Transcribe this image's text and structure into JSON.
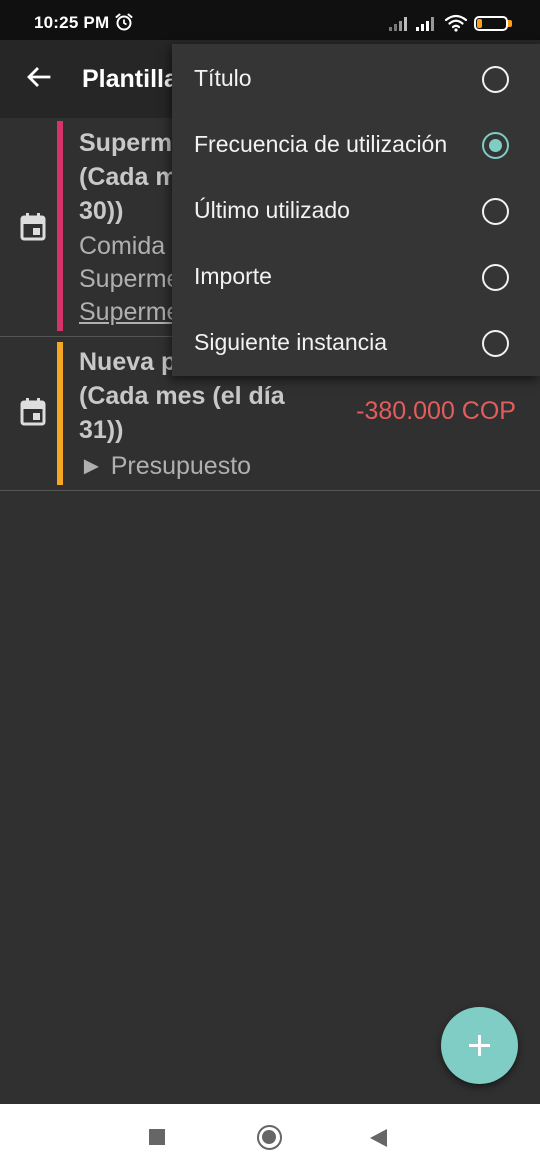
{
  "status_bar": {
    "time": "10:25 PM",
    "battery": "19",
    "battery_level": 0.19,
    "icons": [
      "alarm-icon",
      "signal-icon",
      "signal-icon",
      "wifi-icon",
      "battery-icon"
    ]
  },
  "app_bar": {
    "title": "Plantillas",
    "back_icon": "arrow-left-icon"
  },
  "list": {
    "rows": [
      {
        "title_lines": [
          "Supermercado",
          "(Cada mes (el día",
          "30))"
        ],
        "sub_lines": [
          "Comida",
          "Supermercado",
          "Supermercado"
        ],
        "amount": "",
        "accent": "#d6336c",
        "icon": "calendar-icon"
      },
      {
        "title_lines": [
          "Nueva plantilla",
          "(Cada mes (el día",
          "31))"
        ],
        "sub_lines": [
          "► Presupuesto"
        ],
        "amount": "-380.000 COP",
        "accent": "#f5a623",
        "icon": "calendar-icon"
      }
    ]
  },
  "sort_menu": {
    "items": [
      {
        "label": "Título",
        "selected": false
      },
      {
        "label": "Frecuencia de utilización",
        "selected": true
      },
      {
        "label": "Último utilizado",
        "selected": false
      },
      {
        "label": "Importe",
        "selected": false
      },
      {
        "label": "Siguiente instancia",
        "selected": false
      }
    ]
  },
  "fab": {
    "icon": "plus-icon"
  },
  "nav_bar": {
    "icons": [
      "recents-icon",
      "home-icon",
      "back-icon"
    ]
  },
  "colors": {
    "accent": "#7fcdc4",
    "negative": "#e35d5d",
    "background": "#303030"
  }
}
